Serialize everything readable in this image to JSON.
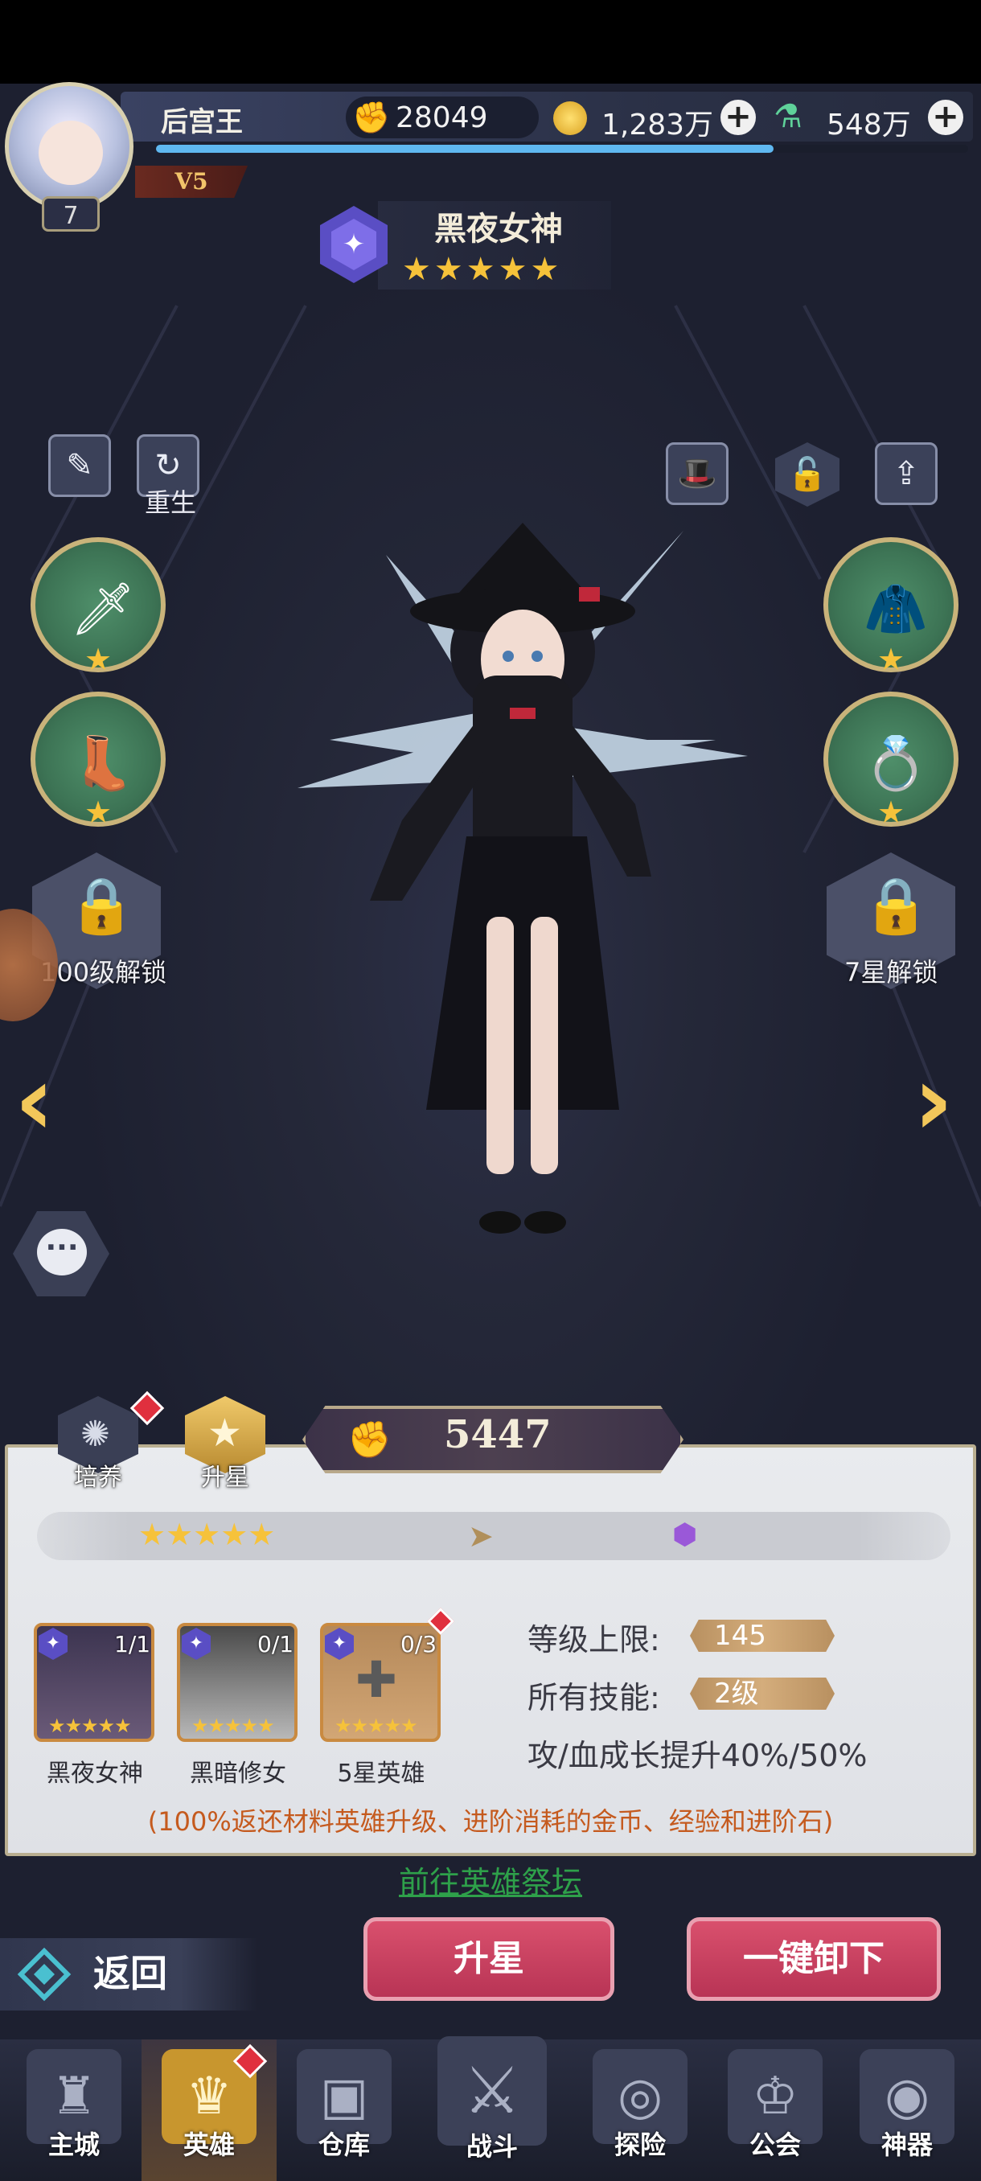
{
  "player": {
    "name": "后宫王",
    "vip": "V5",
    "level": "7",
    "exp_fraction": 0.76
  },
  "resources": {
    "gems": "28049",
    "gold": "1,283万",
    "potion": "548万",
    "gem_icon": "gem-hand-icon",
    "gold_icon": "gold-coin-icon",
    "potion_icon": "potion-bottle-icon"
  },
  "hero": {
    "name": "黑夜女神",
    "stars": "★★★★★",
    "power": "5447",
    "class_icon": "star-hexagon-icon"
  },
  "controls": {
    "rebirth": "重生",
    "left_slot_lock": "100级解锁",
    "right_slot_lock": "7星解锁"
  },
  "tabs": [
    {
      "label": "培养"
    },
    {
      "label": "升星"
    }
  ],
  "star_upgrade": {
    "current_stars": "★★★★★",
    "materials": [
      {
        "name": "黑夜女神",
        "count": "1/1",
        "stars": "★★★★★"
      },
      {
        "name": "黑暗修女",
        "count": "0/1",
        "stars": "★★★★★"
      },
      {
        "name": "5星英雄",
        "count": "0/3",
        "stars": "★★★★★"
      }
    ],
    "stats": {
      "level_cap_label": "等级上限:",
      "level_cap_value": "145",
      "skills_label": "所有技能:",
      "skills_value": "2级",
      "growth": "攻/血成长提升40%/50%"
    },
    "note": "(100%返还材料英雄升级、进阶消耗的金币、经验和进阶石)",
    "link": "前往英雄祭坛"
  },
  "actions": {
    "back": "返回",
    "upgrade": "升星",
    "unequip_all": "一键卸下"
  },
  "nav": [
    {
      "label": "主城",
      "icon": "castle-icon"
    },
    {
      "label": "英雄",
      "icon": "hero-icon"
    },
    {
      "label": "仓库",
      "icon": "warehouse-icon"
    },
    {
      "label": "战斗",
      "icon": "sword-icon"
    },
    {
      "label": "探险",
      "icon": "vortex-icon"
    },
    {
      "label": "公会",
      "icon": "guild-crown-icon"
    },
    {
      "label": "神器",
      "icon": "artifact-eye-icon"
    }
  ],
  "colors": {
    "accent_gold": "#f6c23a",
    "button_pink": "#c9405f",
    "link_green": "#2ea04a",
    "note_orange": "#c55a1e"
  }
}
